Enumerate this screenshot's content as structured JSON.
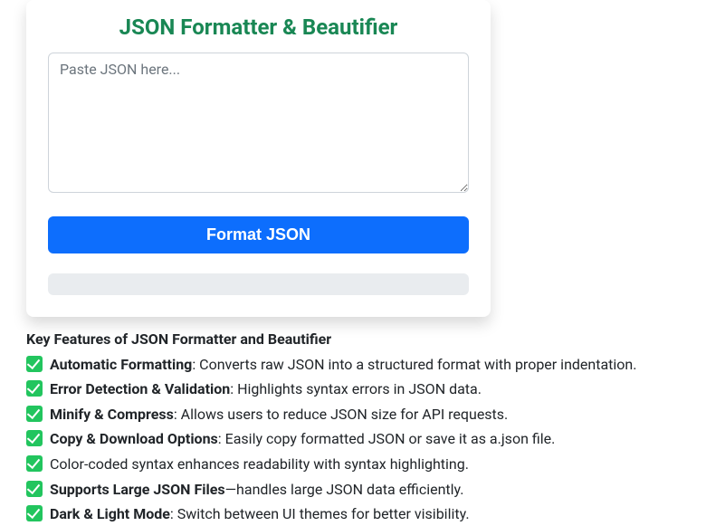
{
  "card": {
    "title": "JSON Formatter & Beautifier",
    "input_placeholder": "Paste JSON here...",
    "input_value": "",
    "button_label": "Format JSON"
  },
  "features": {
    "heading": "Key Features of JSON Formatter and Beautifier",
    "items": [
      {
        "bold": "Automatic Formatting",
        "rest": ": Converts raw JSON into a structured format with proper indentation."
      },
      {
        "bold": "Error Detection & Validation",
        "rest": ": Highlights syntax errors in JSON data."
      },
      {
        "bold": "Minify & Compress",
        "rest": ": Allows users to reduce JSON size for API requests."
      },
      {
        "bold": "Copy & Download Options",
        "rest": ": Easily copy formatted JSON or save it as a.json file."
      },
      {
        "bold": "",
        "rest": "Color-coded syntax enhances readability with syntax highlighting."
      },
      {
        "bold": "Supports Large JSON Files",
        "rest": "—handles large JSON data efficiently."
      },
      {
        "bold": "Dark & Light Mode",
        "rest": ": Switch between UI themes for better visibility."
      }
    ]
  }
}
